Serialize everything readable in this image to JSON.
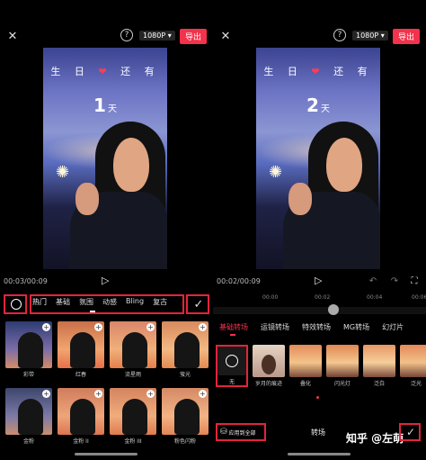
{
  "left": {
    "resolution": "1080P",
    "export_label": "导出",
    "video_title": "生 日",
    "video_title_after": "还 有",
    "video_day": "1",
    "video_day_unit": "天",
    "time": "00:03/00:09",
    "tabs": [
      "热门",
      "基础",
      "氛围",
      "动感",
      "Bling",
      "复古"
    ],
    "filters": [
      {
        "label": "彩带"
      },
      {
        "label": "红春"
      },
      {
        "label": "流星雨"
      },
      {
        "label": "萤光"
      },
      {
        "label": "金粉"
      },
      {
        "label": "金粉 II"
      },
      {
        "label": "金粉 III"
      },
      {
        "label": "粉色闪粉"
      }
    ]
  },
  "right": {
    "resolution": "1080P",
    "export_label": "导出",
    "video_title": "生 日",
    "video_title_after": "还 有",
    "video_day": "2",
    "video_day_unit": "天",
    "time": "00:02/00:09",
    "scrub_marks": [
      "00:00",
      "00:02",
      "00:04",
      "00:06"
    ],
    "tabs": [
      "基础转场",
      "运镜转场",
      "特效转场",
      "MG转场",
      "幻灯片"
    ],
    "transitions": [
      "无",
      "岁月的痕迹",
      "叠化",
      "闪光灯",
      "泛白",
      "泛光"
    ],
    "apply_all_label": "应用到全部",
    "bottom_title": "转场"
  },
  "watermark": "知乎 @左萌",
  "colors": {
    "accent": "#f3324b",
    "highlight_box": "#e3243b"
  }
}
